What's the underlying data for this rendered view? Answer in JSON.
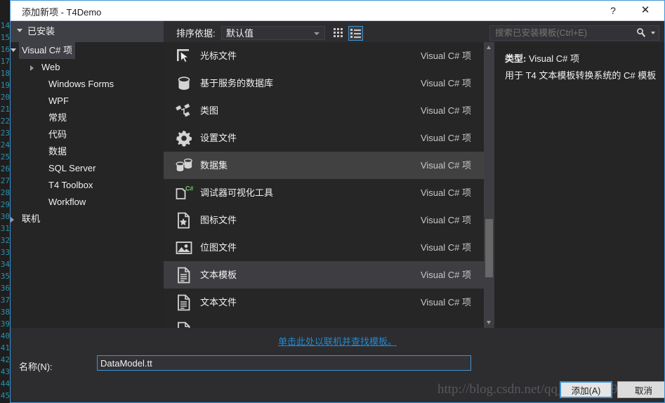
{
  "window": {
    "title": "添加新项 - T4Demo",
    "help_label": "?",
    "close_label": "✕"
  },
  "toolbar": {
    "installed_label": "已安装",
    "sort_by_label": "排序依据:",
    "sort_by_value": "默认值",
    "grid_view_icon": "grid-view-icon",
    "list_view_icon": "list-view-icon"
  },
  "search": {
    "placeholder": "搜索已安装模板(Ctrl+E)",
    "icon": "search-icon"
  },
  "tree": {
    "items": [
      {
        "label": "Visual C# 项",
        "indent": 12,
        "arrow": "expanded",
        "selected": true
      },
      {
        "label": "Web",
        "indent": 40,
        "arrow": "collapsed",
        "selected": false
      },
      {
        "label": "Windows Forms",
        "indent": 50,
        "arrow": "none",
        "selected": false
      },
      {
        "label": "WPF",
        "indent": 50,
        "arrow": "none",
        "selected": false
      },
      {
        "label": "常规",
        "indent": 50,
        "arrow": "none",
        "selected": false
      },
      {
        "label": "代码",
        "indent": 50,
        "arrow": "none",
        "selected": false
      },
      {
        "label": "数据",
        "indent": 50,
        "arrow": "none",
        "selected": false
      },
      {
        "label": "SQL Server",
        "indent": 50,
        "arrow": "none",
        "selected": false
      },
      {
        "label": "T4 Toolbox",
        "indent": 50,
        "arrow": "none",
        "selected": false
      },
      {
        "label": "Workflow",
        "indent": 50,
        "arrow": "none",
        "selected": false
      },
      {
        "label": "联机",
        "indent": 12,
        "arrow": "collapsed",
        "selected": false
      }
    ]
  },
  "list": {
    "items": [
      {
        "name": "光标文件",
        "kind": "Visual C# 项",
        "icon": "cursor-file-icon",
        "state": "normal"
      },
      {
        "name": "基于服务的数据库",
        "kind": "Visual C# 项",
        "icon": "database-icon",
        "state": "normal"
      },
      {
        "name": "类图",
        "kind": "Visual C# 项",
        "icon": "class-diagram-icon",
        "state": "normal"
      },
      {
        "name": "设置文件",
        "kind": "Visual C# 项",
        "icon": "settings-gear-icon",
        "state": "normal"
      },
      {
        "name": "数据集",
        "kind": "Visual C# 项",
        "icon": "dataset-icon",
        "state": "hovered"
      },
      {
        "name": "调试器可视化工具",
        "kind": "Visual C# 项",
        "icon": "debugger-visualizer-icon",
        "state": "normal"
      },
      {
        "name": "图标文件",
        "kind": "Visual C# 项",
        "icon": "icon-file-icon",
        "state": "normal"
      },
      {
        "name": "位图文件",
        "kind": "Visual C# 项",
        "icon": "bitmap-file-icon",
        "state": "normal"
      },
      {
        "name": "文本模板",
        "kind": "Visual C# 项",
        "icon": "text-document-icon",
        "state": "selected"
      },
      {
        "name": "文本文件",
        "kind": "Visual C# 项",
        "icon": "text-document-icon",
        "state": "normal"
      },
      {
        "name": "",
        "kind": "",
        "icon": "text-document-icon",
        "state": "normal"
      }
    ]
  },
  "details": {
    "type_label": "类型:",
    "type_value": "Visual C# 项",
    "description": "用于 T4 文本模板转换系统的 C# 模板"
  },
  "footer": {
    "online_link": "单击此处以联机并查找模板。",
    "name_label": "名称(N):",
    "name_value": "DataModel.tt",
    "add_button": "添加(A)",
    "cancel_button": "取消",
    "watermark": "http://blog.csdn.net/qq_34788759"
  },
  "colors": {
    "accent": "#3f93d4",
    "dialog_bg": "#2d2d30",
    "list_bg": "#262626",
    "row_hover": "#414141",
    "row_selected": "#3e3e42",
    "link": "#1f8ad2"
  }
}
